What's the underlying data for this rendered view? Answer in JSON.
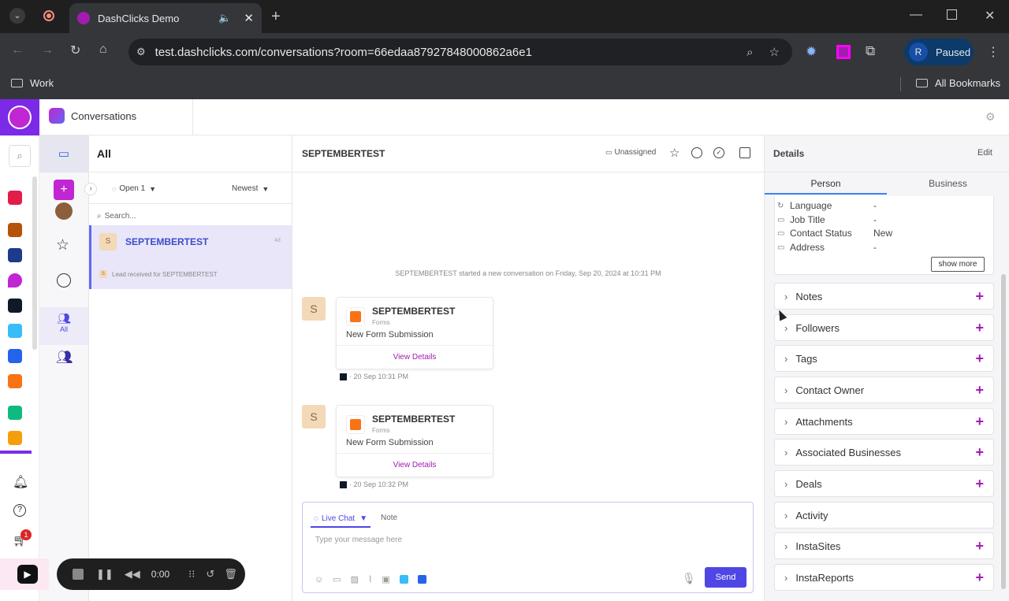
{
  "browser": {
    "tab_title": "DashClicks Demo",
    "url": "test.dashclicks.com/conversations?room=66edaa87927848000862a6e1",
    "profile_initial": "R",
    "profile_status": "Paused",
    "bookmark_folder": "Work",
    "all_bookmarks": "All Bookmarks"
  },
  "app": {
    "section_title": "Conversations",
    "list": {
      "title": "All",
      "filter_status": "Open 1",
      "sort": "Newest",
      "search_placeholder": "Search...",
      "items": [
        {
          "initial": "S",
          "name": "SEPTEMBERTEST",
          "preview": "Lead received for SEPTEMBERTEST",
          "time": "4d"
        }
      ]
    },
    "nav": {
      "all_label": "All"
    },
    "chat": {
      "title": "SEPTEMBERTEST",
      "assignee": "Unassigned",
      "system_message": "SEPTEMBERTEST started a new conversation on Friday, Sep 20, 2024 at 10:31 PM",
      "messages": [
        {
          "initial": "S",
          "sender": "SEPTEMBERTEST",
          "source": "Forms",
          "body": "New Form Submission",
          "action": "View Details",
          "time": "· 20 Sep 10:31 PM"
        },
        {
          "initial": "S",
          "sender": "SEPTEMBERTEST",
          "source": "Forms",
          "body": "New Form Submission",
          "action": "View Details",
          "time": "· 20 Sep 10:32 PM"
        }
      ],
      "composer": {
        "mode": "Live Chat",
        "alt_mode": "Note",
        "placeholder": "Type your message here",
        "send": "Send"
      }
    },
    "details": {
      "title": "Details",
      "edit": "Edit",
      "tabs": [
        "Person",
        "Business"
      ],
      "fields": [
        {
          "label": "Language",
          "value": "-"
        },
        {
          "label": "Job Title",
          "value": "-"
        },
        {
          "label": "Contact Status",
          "value": "New"
        },
        {
          "label": "Address",
          "value": "-"
        }
      ],
      "show_more": "show more",
      "sections": [
        "Notes",
        "Followers",
        "Tags",
        "Contact Owner",
        "Attachments",
        "Associated Businesses",
        "Deals",
        "Activity",
        "InstaSites",
        "InstaReports"
      ]
    }
  },
  "recorder": {
    "time": "0:00",
    "cart_badge": "1"
  },
  "colors": {
    "accent": "#a21caf",
    "send": "#4f46e5",
    "selected_row": "#e8e6f8"
  }
}
